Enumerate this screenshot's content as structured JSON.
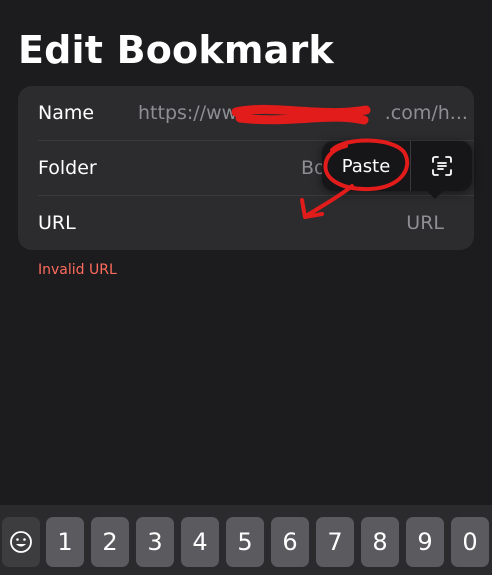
{
  "header": {
    "title": "Edit Bookmark"
  },
  "form": {
    "name": {
      "label": "Name",
      "value_start": "https://www",
      "value_end": ".com/h..."
    },
    "folder": {
      "label": "Folder",
      "value": "Book"
    },
    "url": {
      "label": "URL",
      "placeholder": "URL"
    },
    "error": "Invalid URL"
  },
  "popover": {
    "paste_label": "Paste",
    "scan_icon": "text-scan-icon"
  },
  "keyboard": {
    "emoji_icon": "emoji-icon",
    "keys": [
      "1",
      "2",
      "3",
      "4",
      "5",
      "6",
      "7",
      "8",
      "9",
      "0"
    ]
  },
  "colors": {
    "background": "#1c1c1e",
    "card": "#2c2c2e",
    "error": "#ff6b5e",
    "annotation": "#e21b1b"
  }
}
